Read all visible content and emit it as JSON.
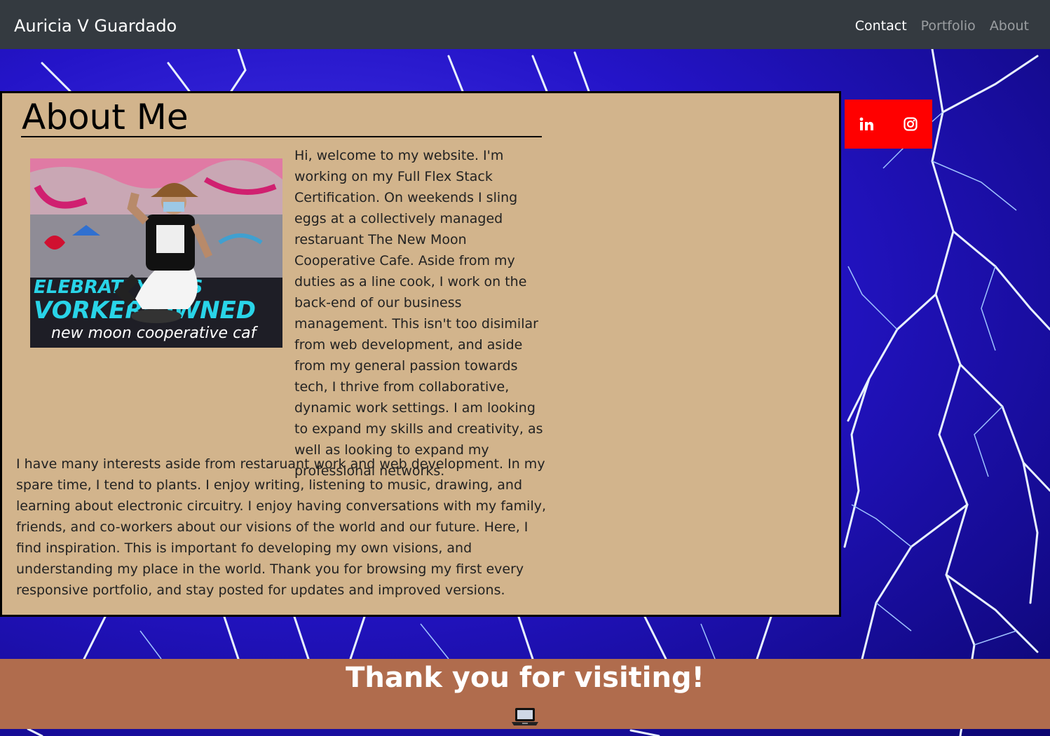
{
  "navbar": {
    "brand": "Auricia V Guardado",
    "links": [
      {
        "label": "Contact"
      },
      {
        "label": "Portfolio"
      },
      {
        "label": "About"
      }
    ]
  },
  "about": {
    "title": "About Me",
    "photo_icon": "profile-photo",
    "paragraph1": "Hi, welcome to my website. I'm working on my Full Flex Stack Certification. On weekends I sling eggs at a collectively managed restaruant The New Moon Cooperative Cafe. Aside from my duties as a line cook, I work on the back-end of our business management. This isn't too disimilar from web development, and aside from my general passion towards tech, I thrive from collaborative, dynamic work settings. I am looking to expand my skills and creativity, as well as looking to expand my professional networks.",
    "paragraph2": "I have many interests aside from restaruant work and web development. In my spare time, I tend to plants. I enjoy writing, listening to music, drawing, and learning about electronic circuitry. I enjoy having conversations with my family, friends, and co-workers about our visions of the world and our future. Here, I find inspiration. This is important fo developing my own visions, and understanding my place in the world. Thank you for browsing my first every responsive portfolio, and stay posted for updates and improved versions."
  },
  "social": {
    "icons": [
      "linkedin-icon",
      "instagram-icon"
    ],
    "color": "#ff0000"
  },
  "footer": {
    "message": "Thank you for visiting!",
    "icon": "laptop-icon",
    "color": "#b06c4d"
  },
  "colors": {
    "navbar": "#343a40",
    "card": "#d2b48c"
  }
}
